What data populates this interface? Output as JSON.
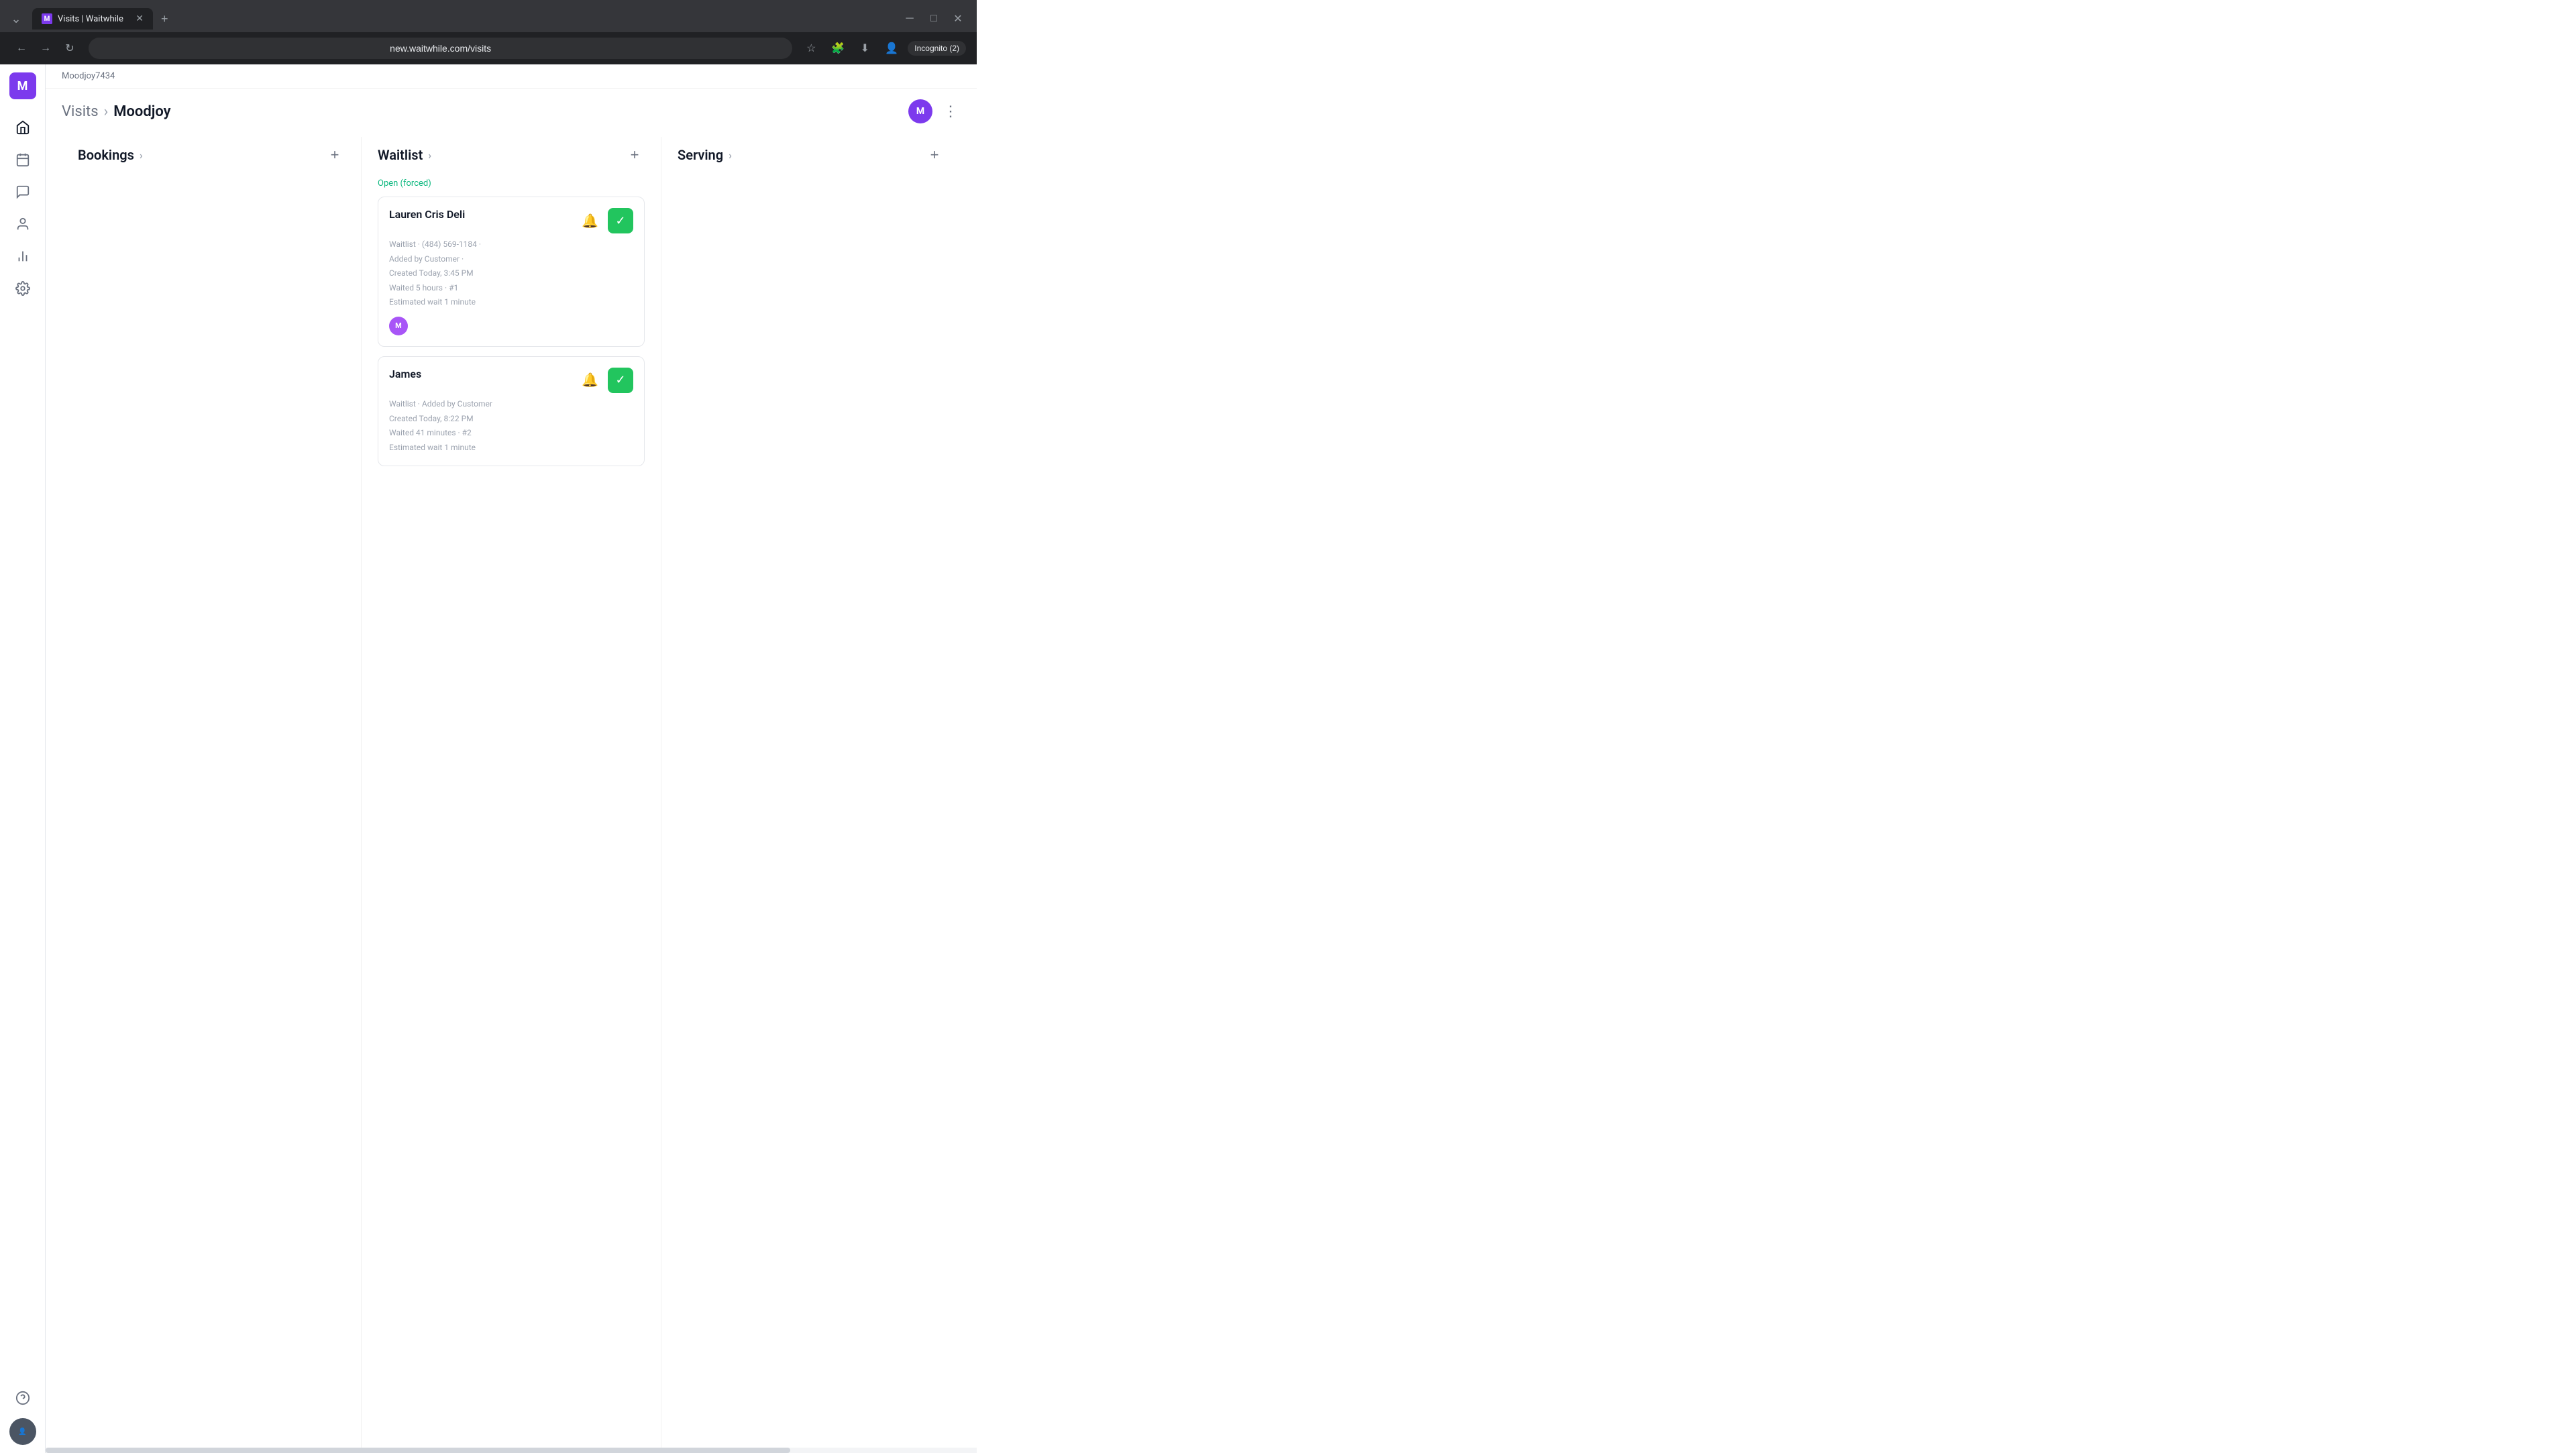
{
  "browser": {
    "tab_favicon": "M",
    "tab_title": "Visits | Waitwhile",
    "tab_close": "✕",
    "new_tab": "+",
    "back_btn": "←",
    "forward_btn": "→",
    "refresh_btn": "↻",
    "address": "new.waitwhile.com/visits",
    "incognito_label": "Incognito (2)",
    "nav_expand": "⌄"
  },
  "org": {
    "name": "Moodjoy7434",
    "logo_letter": "M"
  },
  "page": {
    "breadcrumb_parent": "Visits",
    "breadcrumb_separator": "›",
    "breadcrumb_current": "Moodjoy",
    "user_avatar_letter": "M",
    "more_icon": "⋮"
  },
  "sidebar": {
    "logo_letter": "M",
    "items": [
      {
        "label": "Home",
        "icon": "home"
      },
      {
        "label": "Calendar",
        "icon": "calendar"
      },
      {
        "label": "Chat",
        "icon": "chat"
      },
      {
        "label": "Customers",
        "icon": "customers"
      },
      {
        "label": "Analytics",
        "icon": "analytics"
      },
      {
        "label": "Settings",
        "icon": "settings"
      }
    ],
    "help_icon": "help",
    "user_avatar_bg": "#4b5563"
  },
  "columns": [
    {
      "id": "bookings",
      "title": "Bookings",
      "has_arrow": true,
      "add_visible": true,
      "items": []
    },
    {
      "id": "waitlist",
      "title": "Waitlist",
      "has_arrow": true,
      "add_visible": true,
      "status_label": "Open (forced)",
      "items": [
        {
          "id": "visit-1",
          "name": "Lauren Cris Deli",
          "line1": "Waitlist · (484) 569-1184 ·",
          "line2": "Added by Customer ·",
          "line3": "Created Today, 3:45 PM",
          "line4": "Waited 5 hours · #1",
          "line5": "Estimated wait 1 minute",
          "avatar_letter": "M",
          "avatar_bg": "#a855f7"
        },
        {
          "id": "visit-2",
          "name": "James",
          "line1": "Waitlist · Added by Customer",
          "line2": "Created Today, 8:22 PM",
          "line3": "Waited 41 minutes · #2",
          "line4": "Estimated wait 1 minute",
          "avatar_letter": null
        }
      ]
    },
    {
      "id": "serving",
      "title": "Serving",
      "has_arrow": true,
      "add_visible": true,
      "items": []
    }
  ]
}
